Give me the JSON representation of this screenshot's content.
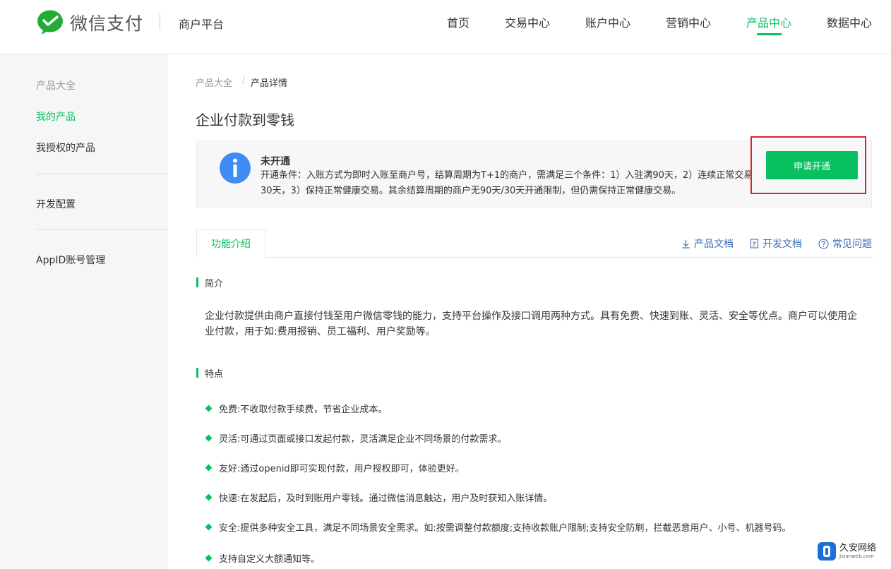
{
  "header": {
    "logo_text": "微信支付",
    "platform": "商户平台",
    "nav": [
      {
        "label": "首页",
        "active": false
      },
      {
        "label": "交易中心",
        "active": false
      },
      {
        "label": "账户中心",
        "active": false
      },
      {
        "label": "营销中心",
        "active": false
      },
      {
        "label": "产品中心",
        "active": true
      },
      {
        "label": "数据中心",
        "active": false
      }
    ],
    "accent_color": "#07c160"
  },
  "sidebar": {
    "items": [
      {
        "label": "产品大全"
      },
      {
        "label": "我的产品"
      },
      {
        "label": "我授权的产品"
      },
      {
        "label": "开发配置"
      },
      {
        "label": "AppID账号管理"
      }
    ]
  },
  "breadcrumb": {
    "items": [
      "产品大全",
      "产品详情"
    ],
    "separator": "/"
  },
  "page": {
    "title": "企业付款到零钱"
  },
  "status": {
    "title": "未开通",
    "description": "开通条件：入账方式为即时入账至商户号，结算周期为T+1的商户，需满足三个条件：1）入驻满90天，2）连续正常交易30天，3）保持正常健康交易。其余结算周期的商户无90天/30天开通限制，但仍需保持正常健康交易。",
    "apply_label": "申请开通",
    "icon": "info-icon"
  },
  "tabs": {
    "active_label": "功能介绍",
    "links": [
      {
        "label": "产品文档",
        "icon": "download-icon"
      },
      {
        "label": "开发文档",
        "icon": "document-icon"
      },
      {
        "label": "常见问题",
        "icon": "question-icon"
      }
    ]
  },
  "intro": {
    "title": "简介",
    "text": "企业付款提供由商户直接付钱至用户微信零钱的能力，支持平台操作及接口调用两种方式。具有免费、快速到账、灵活、安全等优点。商户可以使用企业付款，用于如:费用报销、员工福利、用户奖励等。"
  },
  "features": {
    "title": "特点",
    "items": [
      "免费:不收取付款手续费，节省企业成本。",
      "灵活:可通过页面或接口发起付款，灵活满足企业不同场景的付款需求。",
      "友好:通过openid即可实现付款，用户授权即可，体验更好。",
      "快速:在发起后，及时到账用户零钱。通过微信消息触达，用户及时获知入账详情。",
      "安全:提供多种安全工具，满足不同场景安全需求。如:按需调整付款额度;支持收款账户限制;支持安全防刷，拦截恶意用户、小号、机器号码。",
      "支持自定义大额通知等。"
    ]
  },
  "watermark": {
    "name": "久安网络",
    "domain": "Jiuanweb.com"
  }
}
